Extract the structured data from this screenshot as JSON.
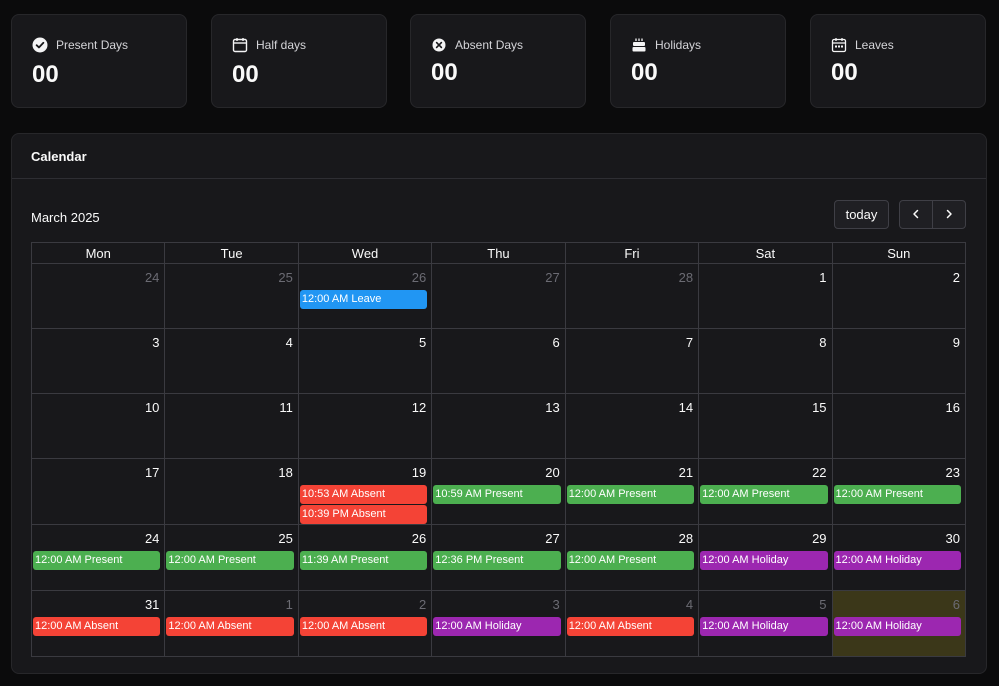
{
  "stats": [
    {
      "label": "Present Days",
      "value": "00",
      "icon": "check-circle-icon"
    },
    {
      "label": "Half days",
      "value": "00",
      "icon": "calendar-icon"
    },
    {
      "label": "Absent Days",
      "value": "00",
      "icon": "x-circle-icon"
    },
    {
      "label": "Holidays",
      "value": "00",
      "icon": "cake-icon"
    },
    {
      "label": "Leaves",
      "value": "00",
      "icon": "calendar-days-icon"
    }
  ],
  "calendar": {
    "title": "Calendar",
    "month_label": "March 2025",
    "today_label": "today",
    "prev_icon": "chevron-left-icon",
    "next_icon": "chevron-right-icon",
    "weekdays": [
      "Mon",
      "Tue",
      "Wed",
      "Thu",
      "Fri",
      "Sat",
      "Sun"
    ],
    "event_colors": {
      "leave": "#2196f3",
      "absent": "#f44336",
      "present": "#4caf50",
      "holiday": "#9c27b0"
    },
    "highlight_color": "#3b3719",
    "weeks": [
      [
        {
          "day": "24",
          "other": true,
          "events": []
        },
        {
          "day": "25",
          "other": true,
          "events": []
        },
        {
          "day": "26",
          "other": true,
          "events": [
            {
              "text": "12:00 AM Leave",
              "type": "leave"
            }
          ]
        },
        {
          "day": "27",
          "other": true,
          "events": []
        },
        {
          "day": "28",
          "other": true,
          "events": []
        },
        {
          "day": "1",
          "events": []
        },
        {
          "day": "2",
          "events": []
        }
      ],
      [
        {
          "day": "3",
          "events": []
        },
        {
          "day": "4",
          "events": []
        },
        {
          "day": "5",
          "events": []
        },
        {
          "day": "6",
          "events": []
        },
        {
          "day": "7",
          "events": []
        },
        {
          "day": "8",
          "events": []
        },
        {
          "day": "9",
          "events": []
        }
      ],
      [
        {
          "day": "10",
          "events": []
        },
        {
          "day": "11",
          "events": []
        },
        {
          "day": "12",
          "events": []
        },
        {
          "day": "13",
          "events": []
        },
        {
          "day": "14",
          "events": []
        },
        {
          "day": "15",
          "events": []
        },
        {
          "day": "16",
          "events": []
        }
      ],
      [
        {
          "day": "17",
          "events": []
        },
        {
          "day": "18",
          "events": []
        },
        {
          "day": "19",
          "events": [
            {
              "text": "10:53 AM Absent",
              "type": "absent"
            },
            {
              "text": "10:39 PM Absent",
              "type": "absent"
            }
          ]
        },
        {
          "day": "20",
          "events": [
            {
              "text": "10:59 AM Present",
              "type": "present"
            }
          ]
        },
        {
          "day": "21",
          "events": [
            {
              "text": "12:00 AM Present",
              "type": "present"
            }
          ]
        },
        {
          "day": "22",
          "events": [
            {
              "text": "12:00 AM Present",
              "type": "present"
            }
          ]
        },
        {
          "day": "23",
          "events": [
            {
              "text": "12:00 AM Present",
              "type": "present"
            }
          ]
        }
      ],
      [
        {
          "day": "24",
          "events": [
            {
              "text": "12:00 AM Present",
              "type": "present"
            }
          ]
        },
        {
          "day": "25",
          "events": [
            {
              "text": "12:00 AM Present",
              "type": "present"
            }
          ]
        },
        {
          "day": "26",
          "events": [
            {
              "text": "11:39 AM Present",
              "type": "present"
            }
          ]
        },
        {
          "day": "27",
          "events": [
            {
              "text": "12:36 PM Present",
              "type": "present"
            }
          ]
        },
        {
          "day": "28",
          "events": [
            {
              "text": "12:00 AM Present",
              "type": "present"
            }
          ]
        },
        {
          "day": "29",
          "events": [
            {
              "text": "12:00 AM Holiday",
              "type": "holiday"
            }
          ]
        },
        {
          "day": "30",
          "events": [
            {
              "text": "12:00 AM Holiday",
              "type": "holiday"
            }
          ]
        }
      ],
      [
        {
          "day": "31",
          "events": [
            {
              "text": "12:00 AM Absent",
              "type": "absent"
            }
          ]
        },
        {
          "day": "1",
          "other": true,
          "events": [
            {
              "text": "12:00 AM Absent",
              "type": "absent"
            }
          ]
        },
        {
          "day": "2",
          "other": true,
          "events": [
            {
              "text": "12:00 AM Absent",
              "type": "absent"
            }
          ]
        },
        {
          "day": "3",
          "other": true,
          "events": [
            {
              "text": "12:00 AM Holiday",
              "type": "holiday"
            }
          ]
        },
        {
          "day": "4",
          "other": true,
          "events": [
            {
              "text": "12:00 AM Absent",
              "type": "absent"
            }
          ]
        },
        {
          "day": "5",
          "other": true,
          "events": [
            {
              "text": "12:00 AM Holiday",
              "type": "holiday"
            }
          ]
        },
        {
          "day": "6",
          "other": true,
          "highlight": true,
          "events": [
            {
              "text": "12:00 AM Holiday",
              "type": "holiday"
            }
          ]
        }
      ]
    ]
  }
}
